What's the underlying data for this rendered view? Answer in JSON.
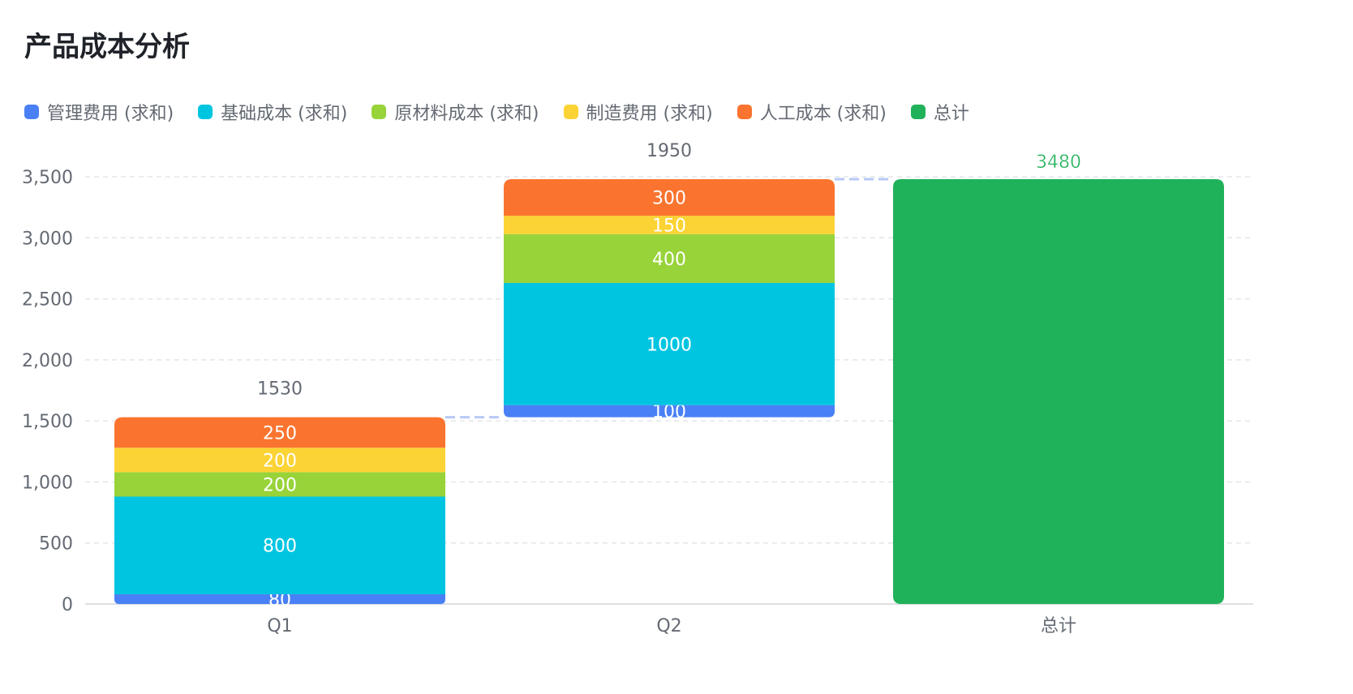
{
  "title": "产品成本分析",
  "chart_data": {
    "type": "bar",
    "subtype": "stacked-waterfall",
    "title": "产品成本分析",
    "categories": [
      "Q1",
      "Q2",
      "总计"
    ],
    "series": [
      {
        "name": "管理费用 (求和)",
        "color": "#4a80f5",
        "values": [
          80,
          100,
          null
        ]
      },
      {
        "name": "基础成本 (求和)",
        "color": "#00c5e1",
        "values": [
          800,
          1000,
          null
        ]
      },
      {
        "name": "原材料成本 (求和)",
        "color": "#98d33a",
        "values": [
          200,
          400,
          null
        ]
      },
      {
        "name": "制造费用 (求和)",
        "color": "#fcd335",
        "values": [
          200,
          150,
          null
        ]
      },
      {
        "name": "人工成本 (求和)",
        "color": "#fa742f",
        "values": [
          250,
          300,
          null
        ]
      },
      {
        "name": "总计",
        "color": "#20b25a",
        "values": [
          null,
          null,
          3480
        ]
      }
    ],
    "bar_totals": [
      "1530",
      "1950",
      "3480"
    ],
    "y_ticks": [
      "0",
      "500",
      "1,000",
      "1,500",
      "2,000",
      "2,500",
      "3,000",
      "3,500"
    ],
    "ylim": [
      0,
      3500
    ],
    "xlabel": "",
    "ylabel": "",
    "grid": true,
    "legend_position": "top-left"
  }
}
